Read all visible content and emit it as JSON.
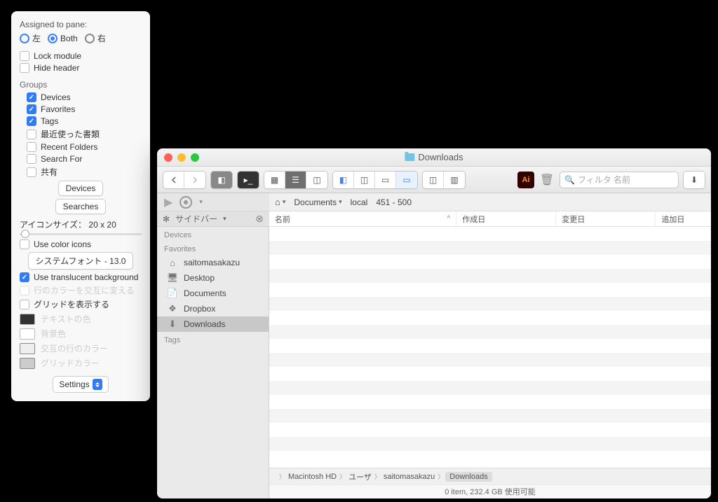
{
  "settings": {
    "assigned_label": "Assigned to pane:",
    "radios": {
      "left": "左",
      "both": "Both",
      "right": "右"
    },
    "lock_module": "Lock module",
    "hide_header": "Hide header",
    "groups_title": "Groups",
    "groups": {
      "devices": "Devices",
      "favorites": "Favorites",
      "tags": "Tags",
      "recent_docs": "最近使った書類",
      "recent_folders": "Recent Folders",
      "search_for": "Search For",
      "shared": "共有"
    },
    "btn_devices": "Devices",
    "btn_searches": "Searches",
    "icon_size_label": "アイコンサイズ：",
    "icon_size_value": "20 x 20",
    "use_color_icons": "Use color icons",
    "font_btn": "システムフォント - 13.0",
    "translucent_bg": "Use translucent background",
    "alt_row_color": "行のカラーを交互に変える",
    "show_grid": "グリッドを表示する",
    "colors": {
      "text": "テキストの色",
      "background": "背景色",
      "alt_row": "交互の行のカラー",
      "grid": "グリッドカラー"
    },
    "settings_btn": "Settings"
  },
  "finder": {
    "title": "Downloads",
    "pathbar": {
      "documents": "Documents",
      "local": "local",
      "range": "451 - 500"
    },
    "sidebar_ctrl": "サイドバー",
    "sidebar": {
      "devices_hdr": "Devices",
      "favorites_hdr": "Favorites",
      "tags_hdr": "Tags",
      "items": {
        "home": "saitomasakazu",
        "desktop": "Desktop",
        "documents": "Documents",
        "dropbox": "Dropbox",
        "downloads": "Downloads"
      }
    },
    "columns": {
      "name": "名前",
      "created": "作成日",
      "modified": "変更日",
      "added": "追加日"
    },
    "search_placeholder": "フィルタ 名前",
    "breadcrumb": {
      "hd": "Macintosh HD",
      "users": "ユーザ",
      "user": "saitomasakazu",
      "downloads": "Downloads"
    },
    "status": "0 item, 232.4 GB 使用可能"
  }
}
